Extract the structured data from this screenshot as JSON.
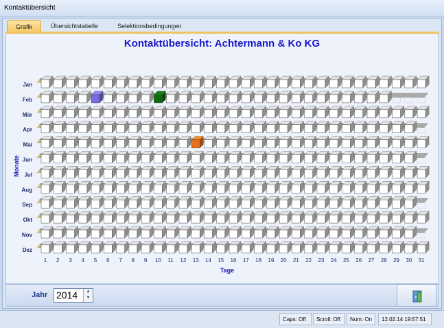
{
  "window": {
    "title": "Kontaktübersicht"
  },
  "tabs": [
    {
      "label": "Grafik",
      "active": true
    },
    {
      "label": "Übersichtstabelle",
      "active": false
    },
    {
      "label": "Selektionsbedingungen",
      "active": false
    }
  ],
  "chart_data": {
    "type": "heatmap",
    "title": "Kontaktübersicht: Achtermann & Ko  KG",
    "xlabel": "Tage",
    "ylabel": "Monate",
    "x": [
      1,
      2,
      3,
      4,
      5,
      6,
      7,
      8,
      9,
      10,
      11,
      12,
      13,
      14,
      15,
      16,
      17,
      18,
      19,
      20,
      21,
      22,
      23,
      24,
      25,
      26,
      27,
      28,
      29,
      30,
      31
    ],
    "months": [
      "Jan",
      "Feb",
      "Mär",
      "Apr",
      "Mai",
      "Jun",
      "Jul",
      "Aug",
      "Sep",
      "Okt",
      "Nov",
      "Dez"
    ],
    "days_in_month": [
      31,
      28,
      31,
      30,
      31,
      30,
      31,
      31,
      30,
      31,
      30,
      31
    ],
    "highlights": [
      {
        "month": "Feb",
        "day": 5,
        "color": "#7b6be0"
      },
      {
        "month": "Feb",
        "day": 10,
        "color": "#0b6a0b"
      },
      {
        "month": "Mai",
        "day": 13,
        "color": "#e8701a"
      }
    ]
  },
  "footer": {
    "jahr_label": "Jahr",
    "jahr_value": "2014"
  },
  "status": {
    "caps": "Caps: Off",
    "scroll": "Scroll: Off",
    "num": "Num: On",
    "datetime": "12.02.14 19:57:51"
  }
}
